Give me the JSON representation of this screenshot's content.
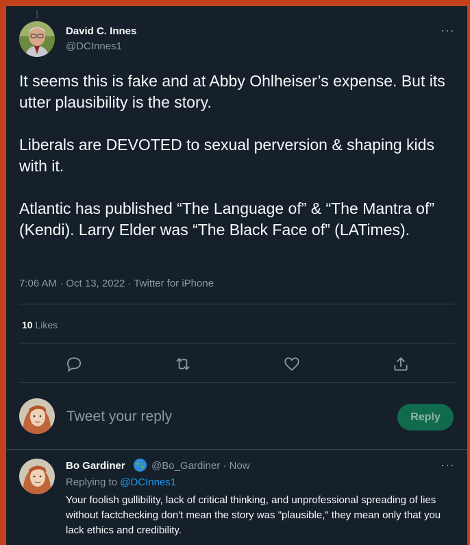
{
  "main_tweet": {
    "author_name": "David C. Innes",
    "author_handle": "@DCInnes1",
    "text": "It seems this is fake and at Abby Ohlheiser’s expense. But its utter plausibility is the story.\n\nLiberals are DEVOTED to sexual perversion & shaping kids with it.\n\nAtlantic has published “The  Language of” & “The Mantra of” (Kendi). Larry Elder was “The Black Face of” (LATimes).",
    "timestamp": "7:06 AM · Oct 13, 2022 · Twitter for iPhone",
    "likes_count": "10",
    "likes_label": "Likes",
    "more_label": "···"
  },
  "actions": {
    "reply_icon": "reply-icon",
    "retweet_icon": "retweet-icon",
    "like_icon": "heart-icon",
    "share_icon": "share-icon"
  },
  "composer": {
    "placeholder": "Tweet your reply",
    "button_label": "Reply"
  },
  "reply": {
    "author_name": "Bo Gardiner",
    "author_handle": "@Bo_Gardiner",
    "time": "· Now",
    "replying_to_label": "Replying to",
    "replying_to_handle": "@DCInnes1",
    "text": "Your foolish gullibility, lack of critical thinking, and unprofessional spreading of lies without factchecking don't mean the story was \"plausible,\" they mean only that you lack ethics and credibility.",
    "more_label": "···"
  },
  "colors": {
    "background": "#15202b",
    "frame": "#c2411c",
    "accent": "#1d9bf0",
    "reply_button": "#0f6a4e"
  }
}
